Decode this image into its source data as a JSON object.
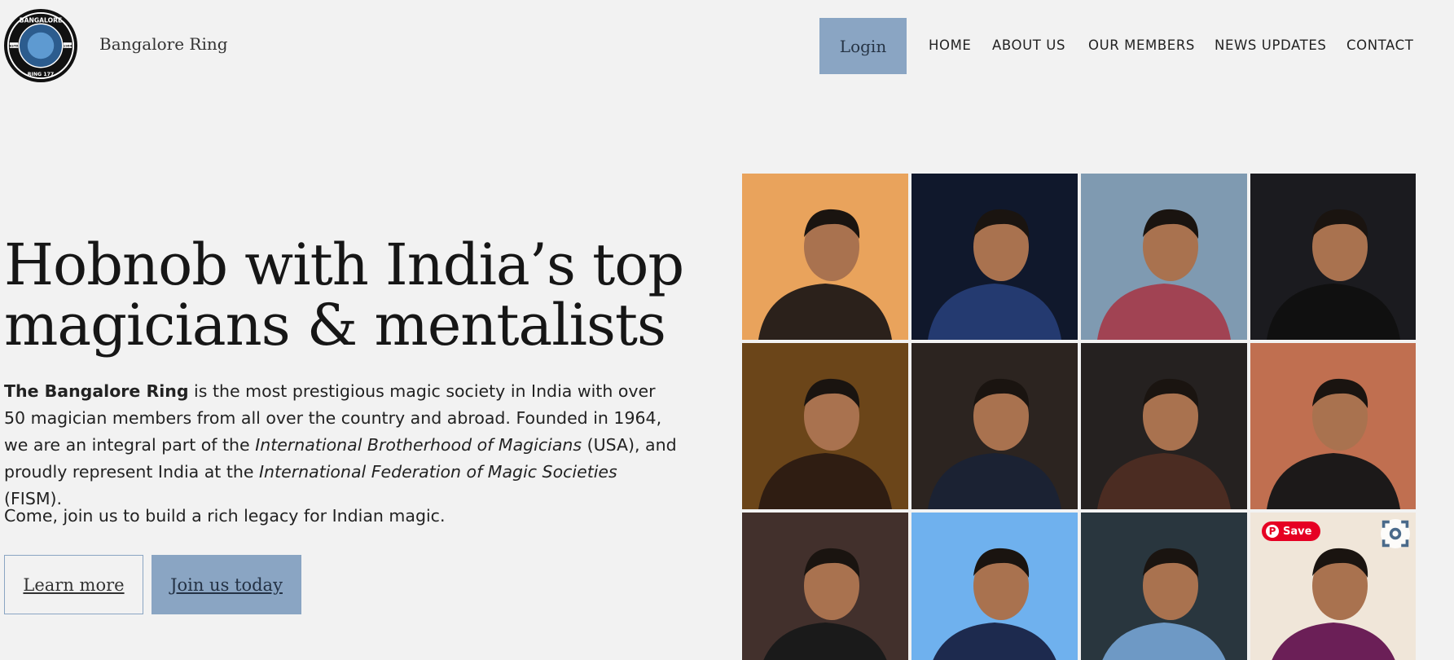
{
  "header": {
    "logo_text": {
      "top": "BANGALORE",
      "bottom": "RING 177",
      "left": "ESTD",
      "right": "1964"
    },
    "site_title": "Bangalore Ring",
    "login_label": "Login",
    "nav": [
      "HOME",
      "ABOUT US",
      "OUR MEMBERS",
      "NEWS UPDATES",
      "CONTACT"
    ]
  },
  "hero": {
    "headline_line1": "Hobnob with India’s top",
    "headline_line2": "magicians & mentalists",
    "intro": {
      "org_name": "The Bangalore Ring",
      "text1": " is the most prestigious magic society in India with over 50 magician members from all over the country and abroad. Founded in 1964, we are an integral part of the ",
      "ibm": "International Brotherhood of Magicians",
      "text2": " (USA), and proudly represent India at the ",
      "fism": "International Federation of Magic Societies",
      "text3": " (FISM)."
    },
    "join_line": "Come, join us to build a rich legacy for Indian magic.",
    "learn_more_label": "Learn more",
    "join_label": "Join us today"
  },
  "gallery": {
    "pin_save_label": "Save",
    "tiles": [
      {
        "bg": "#e9a35c",
        "fg": "#2b211b"
      },
      {
        "bg": "#10182c",
        "fg": "#243a70"
      },
      {
        "bg": "#7f9ab1",
        "fg": "#a14353"
      },
      {
        "bg": "#1b1b1f",
        "fg": "#101010"
      },
      {
        "bg": "#6b4519",
        "fg": "#2f1d12"
      },
      {
        "bg": "#2c2420",
        "fg": "#1b2233"
      },
      {
        "bg": "#252120",
        "fg": "#4b2c22"
      },
      {
        "bg": "#c06f50",
        "fg": "#1c1919"
      },
      {
        "bg": "#42302c",
        "fg": "#1a1a1a"
      },
      {
        "bg": "#6fb1ee",
        "fg": "#1d2a4e"
      },
      {
        "bg": "#29363e",
        "fg": "#6e99c5"
      },
      {
        "bg": "#f0e6d9",
        "fg": "#6b1f57"
      }
    ]
  }
}
